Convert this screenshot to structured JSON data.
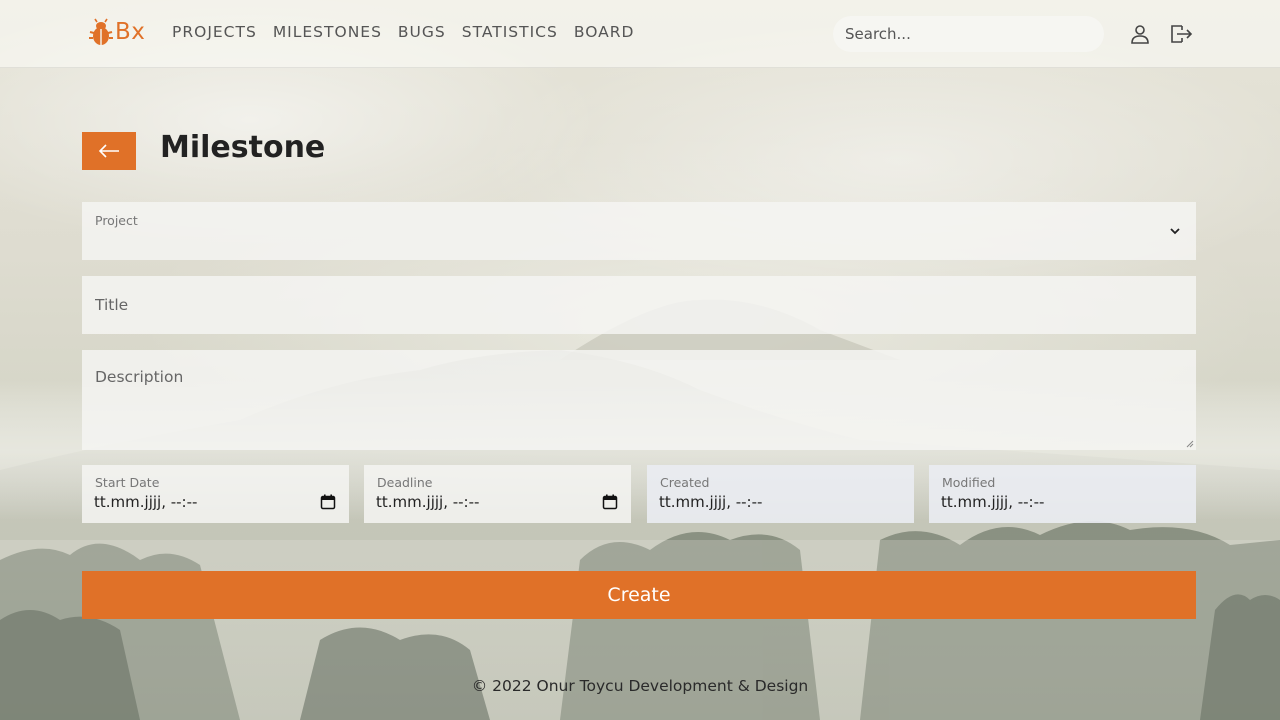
{
  "brand": {
    "logo_text": "Bx",
    "accent": "#e07128"
  },
  "nav": {
    "items": [
      {
        "label": "PROJECTS"
      },
      {
        "label": "MILESTONES"
      },
      {
        "label": "BUGS"
      },
      {
        "label": "STATISTICS"
      },
      {
        "label": "BOARD"
      }
    ]
  },
  "search": {
    "placeholder": "Search..."
  },
  "header_icons": {
    "user": "user-icon",
    "logout": "logout-icon"
  },
  "page": {
    "title": "Milestone",
    "back_icon": "arrow-left-icon"
  },
  "form": {
    "project": {
      "label": "Project",
      "value": ""
    },
    "title": {
      "placeholder": "Title"
    },
    "description": {
      "placeholder": "Description"
    },
    "dates": {
      "start": {
        "label": "Start Date",
        "value": "tt.mm.jjjj, --:--"
      },
      "deadline": {
        "label": "Deadline",
        "value": "tt.mm.jjjj, --:--"
      },
      "created": {
        "label": "Created",
        "value": "tt.mm.jjjj, --:--"
      },
      "modified": {
        "label": "Modified",
        "value": "tt.mm.jjjj, --:--"
      }
    },
    "submit_label": "Create"
  },
  "footer": {
    "text": "© 2022 Onur Toycu Development & Design"
  }
}
